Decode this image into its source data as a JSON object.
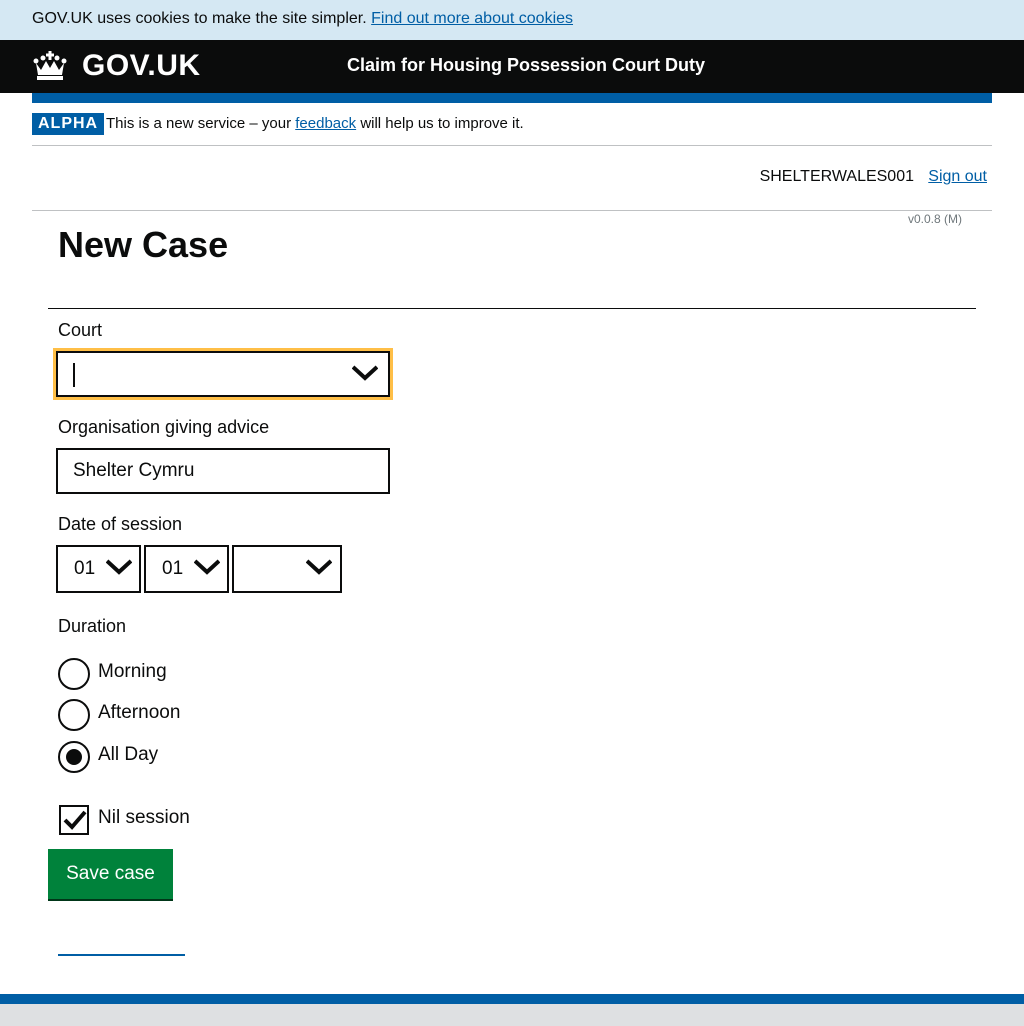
{
  "cookie_banner": {
    "text": "GOV.UK uses cookies to make the site simpler.",
    "link": "Find out more about cookies"
  },
  "header": {
    "logo": "GOV.UK",
    "service_name": "Claim for Housing Possession Court Duty"
  },
  "phase_banner": {
    "tag": "ALPHA",
    "text_before": "This is a new service – your",
    "link": "feedback",
    "text_after": "will help us to improve it."
  },
  "user_bar": {
    "username": "SHELTERWALES001",
    "sign_out": "Sign out"
  },
  "version": "v0.0.8 (M)",
  "page_title": "New Case",
  "form": {
    "court": {
      "label": "Court",
      "value": ""
    },
    "organisation": {
      "label": "Organisation giving advice",
      "value": "Shelter Cymru"
    },
    "date": {
      "label": "Date of session",
      "day": "01",
      "month": "01",
      "year": ""
    },
    "duration": {
      "label": "Duration",
      "options": [
        {
          "label": "Morning",
          "selected": false
        },
        {
          "label": "Afternoon",
          "selected": false
        },
        {
          "label": "All Day",
          "selected": true
        }
      ]
    },
    "nil_session": {
      "label": "Nil session",
      "checked": true
    },
    "save_button": "Save case"
  },
  "colors": {
    "link": "#005ea5",
    "header_bg": "#0b0c0c",
    "button": "#00823b",
    "focus": "#ffbf47",
    "cookie_bg": "#d5e8f3"
  }
}
